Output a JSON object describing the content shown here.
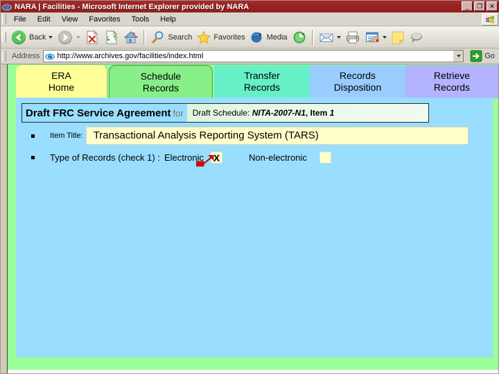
{
  "window": {
    "title": "NARA | Facilities - Microsoft Internet Explorer provided by NARA",
    "minimize_label": "_",
    "restore_label": "❐",
    "close_label": "✕"
  },
  "menu": {
    "items": [
      {
        "label": "File"
      },
      {
        "label": "Edit"
      },
      {
        "label": "View"
      },
      {
        "label": "Favorites"
      },
      {
        "label": "Tools"
      },
      {
        "label": "Help"
      }
    ]
  },
  "toolbar": {
    "back_label": "Back",
    "search_label": "Search",
    "favorites_label": "Favorites",
    "media_label": "Media"
  },
  "address": {
    "label": "Address",
    "value": "http://www.archives.gov/facilities/index.html",
    "go_label": "Go"
  },
  "tabs": [
    {
      "line1": "ERA",
      "line2": "Home",
      "color": "#ffff99",
      "active": false
    },
    {
      "line1": "Schedule",
      "line2": "Records",
      "color": "#88ee88",
      "active": true
    },
    {
      "line1": "Transfer",
      "line2": "Records",
      "color": "#66f0c8",
      "active": false
    },
    {
      "line1": "Records",
      "line2": "Disposition",
      "color": "#99ccff",
      "active": false
    },
    {
      "line1": "Retrieve",
      "line2": "Records",
      "color": "#b3b3ff",
      "active": false
    }
  ],
  "header": {
    "primary": "Draft FRC Service Agreement",
    "for": "for",
    "schedule_prefix": "Draft Schedule:",
    "schedule_number": "NITA-2007-N1",
    "item_label": ", Item",
    "item_number": "1"
  },
  "form": {
    "item_title_label": "Item Title:",
    "item_title_value": "Transactional Analysis Reporting System (TARS)",
    "type_label": "Type of Records (check 1) :",
    "electronic_label": "Electronic",
    "electronic_checked_mark": "X",
    "nonelectronic_label": "Non-electronic",
    "nonelectronic_checked_mark": ""
  },
  "colors": {
    "titlebar": "#992323",
    "page_bg": "#99ff99",
    "panel_bg": "#99ddff",
    "field_bg": "#ffffcc",
    "arrow": "#e00000"
  }
}
